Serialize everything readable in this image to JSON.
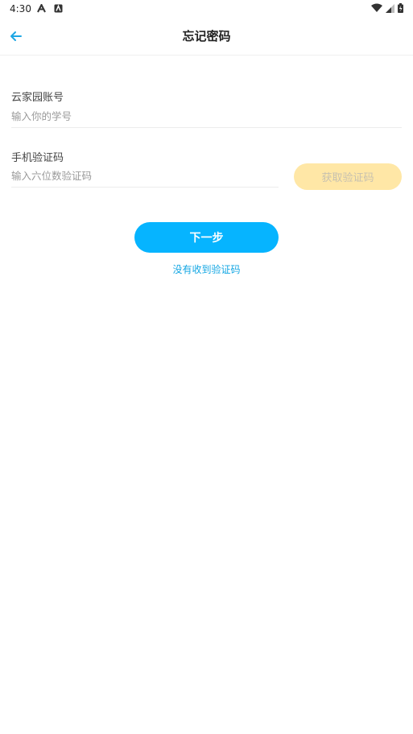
{
  "statusbar": {
    "time": "4:30",
    "icons": [
      "notification-a-icon",
      "notification-box-icon",
      "wifi-icon",
      "signal-icon",
      "battery-icon"
    ]
  },
  "header": {
    "title": "忘记密码",
    "back_icon": "arrow-left-icon"
  },
  "form": {
    "account": {
      "label": "云家园账号",
      "placeholder": "输入你的学号",
      "value": ""
    },
    "sms": {
      "label": "手机验证码",
      "placeholder": "输入六位数验证码",
      "value": "",
      "get_code_label": "获取验证码"
    }
  },
  "actions": {
    "next_label": "下一步",
    "no_code_label": "没有收到验证码"
  },
  "colors": {
    "accent": "#06b4ff",
    "link": "#12a6e3",
    "get_code_bg": "#ffe7a6",
    "get_code_text": "#c7c1b0",
    "back_arrow": "#1ea7e4"
  }
}
